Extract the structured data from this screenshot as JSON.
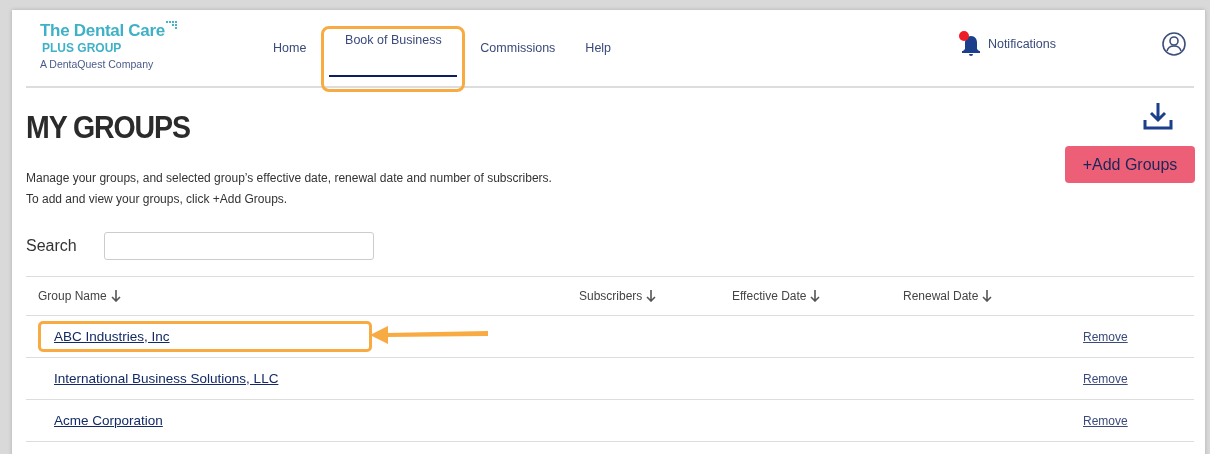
{
  "logo": {
    "line_1": "The Dental Care",
    "line_2": "PLUS GROUP",
    "line_3": "A DentaQuest Company"
  },
  "nav": [
    {
      "label": "Home",
      "selected": false,
      "highlighted": false
    },
    {
      "label": "Book of Business",
      "selected": true,
      "highlighted": true
    },
    {
      "label": "Commissions",
      "selected": false,
      "highlighted": false
    },
    {
      "label": "Help",
      "selected": false,
      "highlighted": false
    }
  ],
  "notifications": {
    "label": "Notifications",
    "unread": true
  },
  "page": {
    "title": "MY GROUPS",
    "description": [
      "Manage your groups, and selected group’s effective date, renewal date and number of subscribers.",
      "To add and view your groups, click +Add Groups."
    ],
    "add_button": "+Add Groups"
  },
  "search": {
    "label": "Search"
  },
  "table": {
    "columns": [
      "Group Name",
      "Subscribers",
      "Effective Date",
      "Renewal Date"
    ],
    "rows": [
      {
        "group_name": "ABC Industries, Inc",
        "action": "Remove",
        "highlighted": true
      },
      {
        "group_name": "International Business Solutions, LLC",
        "action": "Remove",
        "highlighted": false
      },
      {
        "group_name": "Acme Corporation",
        "action": "Remove",
        "highlighted": false
      }
    ]
  }
}
